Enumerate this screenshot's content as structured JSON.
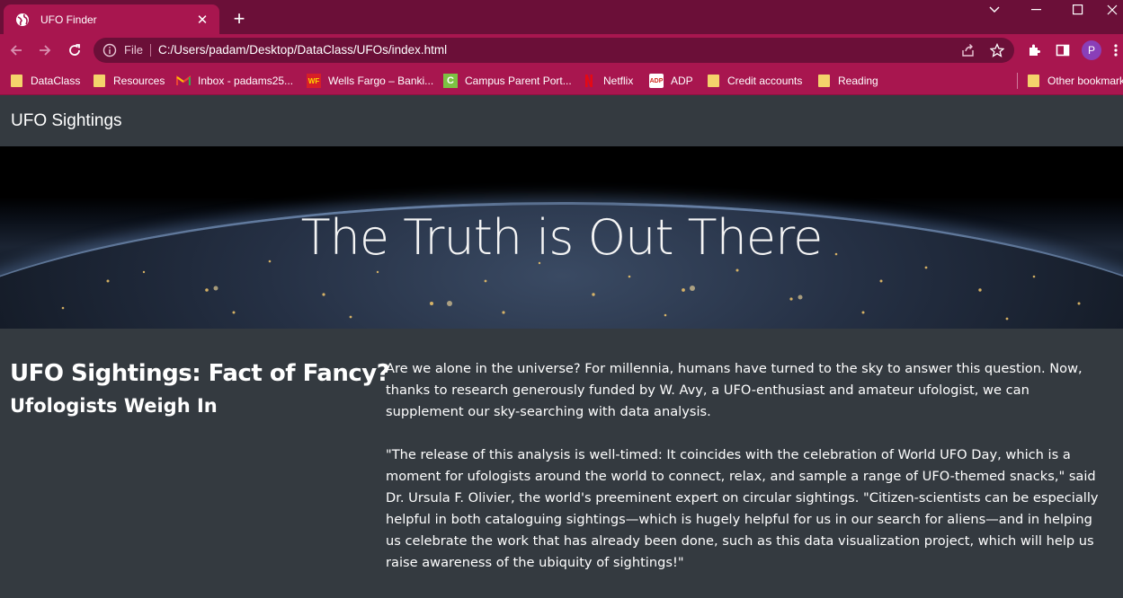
{
  "browser": {
    "tab": {
      "title": "UFO Finder"
    },
    "address": {
      "scheme_label": "File",
      "url": "C:/Users/padam/Desktop/DataClass/UFOs/index.html"
    },
    "profile_initial": "P",
    "bookmarks": [
      {
        "label": "DataClass",
        "icon": "folder-icon"
      },
      {
        "label": "Resources",
        "icon": "folder-icon"
      },
      {
        "label": "Inbox - padams25...",
        "icon": "gmail-icon"
      },
      {
        "label": "Wells Fargo – Banki...",
        "icon": "wellsfargo-icon"
      },
      {
        "label": "Campus Parent Port...",
        "icon": "campus-icon"
      },
      {
        "label": "Netflix",
        "icon": "netflix-icon"
      },
      {
        "label": "ADP",
        "icon": "adp-icon"
      },
      {
        "label": "Credit accounts",
        "icon": "folder-icon"
      },
      {
        "label": "Reading",
        "icon": "folder-icon"
      }
    ],
    "other_bookmarks": "Other bookmarks",
    "colors": {
      "tabstrip": "#6b0f38",
      "toolbar": "#a8164f"
    }
  },
  "page": {
    "navbar_brand": "UFO Sightings",
    "hero_title": "The Truth is Out There",
    "heading": "UFO Sightings: Fact of Fancy?",
    "subheading": "Ufologists Weigh In",
    "paragraph1": "Are we alone in the universe? For millennia, humans have turned to the sky to answer this question. Now, thanks to research generously funded by W. Avy, a UFO-enthusiast and amateur ufologist, we can supplement our sky-searching with data analysis.",
    "paragraph2": "\"The release of this analysis is well-timed: It coincides with the celebration of World UFO Day, which is a moment for ufologists around the world to connect, relax, and sample a range of UFO-themed snacks,\" said Dr. Ursula F. Olivier, the world's preeminent expert on circular sightings. \"Citizen-scientists can be especially helpful in both cataloguing sightings—which is hugely helpful for us in our search for aliens—and in helping us celebrate the work that has already been done, such as this data visualization project, which will help us raise awareness of the ubiquity of sightings!\""
  }
}
